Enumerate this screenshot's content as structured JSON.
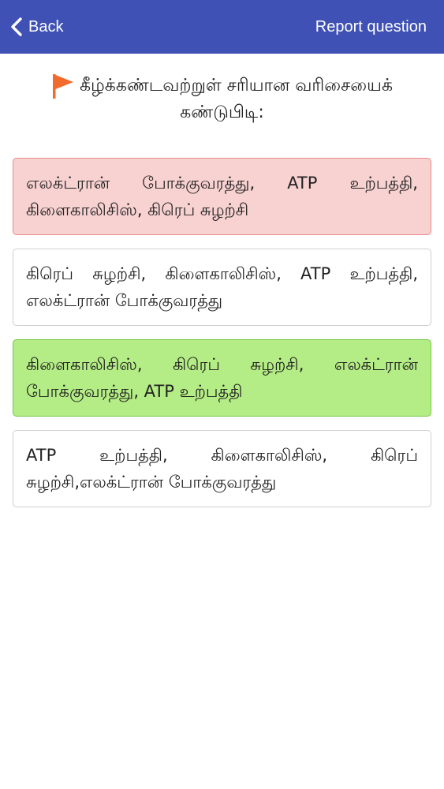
{
  "header": {
    "back_label": "Back",
    "report_label": "Report question",
    "background_color": "#3f51b5",
    "back_icon": "chevron-left-icon"
  },
  "question": {
    "icon": "flag-icon",
    "icon_color": "#f26b2d",
    "text": "கீழ்க்கண்டவற்றுள் சரியான வரிசையைக் கண்டுபிடி:"
  },
  "options": [
    {
      "text": "எலக்ட்ரான் போக்குவரத்து, ATP உற்பத்தி, கிளைகாலிசிஸ், கிரெப் சுழற்சி",
      "state": "wrong",
      "color": "#f8d1d1"
    },
    {
      "text": "கிரெப் சுழற்சி, கிளைகாலிசிஸ், ATP உற்பத்தி, எலக்ட்ரான் போக்குவரத்து",
      "state": "neutral",
      "color": "#ffffff"
    },
    {
      "text": "கிளைகாலிசிஸ், கிரெப் சுழற்சி, எலக்ட்ரான் போக்குவரத்து, ATP உற்பத்தி",
      "state": "correct",
      "color": "#b4ec85"
    },
    {
      "text": "ATP உற்பத்தி, கிளைகாலிசிஸ், கிரெப் சுழற்சி,எலக்ட்ரான் போக்குவரத்து",
      "state": "neutral",
      "color": "#ffffff"
    }
  ]
}
